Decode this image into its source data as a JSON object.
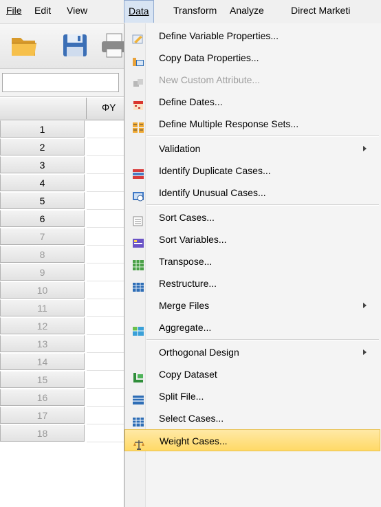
{
  "menubar": {
    "file": "File",
    "edit": "Edit",
    "view": "View",
    "data": "Data",
    "transform": "Transform",
    "analyze": "Analyze",
    "direct_marketing": "Direct Marketi"
  },
  "grid": {
    "col1_label": "ΦY",
    "row_numbers": [
      "1",
      "2",
      "3",
      "4",
      "5",
      "6",
      "7",
      "8",
      "9",
      "10",
      "11",
      "12",
      "13",
      "14",
      "15",
      "16",
      "17",
      "18"
    ]
  },
  "data_menu": {
    "items": [
      {
        "label": "Define Variable Properties...",
        "icon": "define-variable-properties-icon"
      },
      {
        "label": "Copy Data Properties...",
        "icon": "copy-data-properties-icon"
      },
      {
        "label": "New Custom Attribute...",
        "icon": "new-custom-attribute-icon",
        "disabled": true
      },
      {
        "label": "Define Dates...",
        "icon": "calendar-icon"
      },
      {
        "label": "Define Multiple Response Sets...",
        "icon": "multiple-response-icon"
      },
      {
        "label": "Validation",
        "submenu": true
      },
      {
        "label": "Identify Duplicate Cases...",
        "icon": "duplicate-cases-icon"
      },
      {
        "label": "Identify Unusual Cases...",
        "icon": "unusual-cases-icon"
      },
      {
        "label": "Sort Cases...",
        "icon": "sort-cases-icon"
      },
      {
        "label": "Sort Variables...",
        "icon": "sort-variables-icon"
      },
      {
        "label": "Transpose...",
        "icon": "transpose-icon"
      },
      {
        "label": "Restructure...",
        "icon": "restructure-icon"
      },
      {
        "label": "Merge Files",
        "submenu": true
      },
      {
        "label": "Aggregate...",
        "icon": "aggregate-icon"
      },
      {
        "label": "Orthogonal Design",
        "submenu": true
      },
      {
        "label": "Copy Dataset",
        "icon": "copy-dataset-icon"
      },
      {
        "label": "Split File...",
        "icon": "split-file-icon"
      },
      {
        "label": "Select Cases...",
        "icon": "select-cases-icon"
      },
      {
        "label": "Weight Cases...",
        "icon": "weight-cases-icon",
        "highlighted": true
      }
    ]
  },
  "colors": {
    "highlight": "#ffd966",
    "menu_bg": "#f4f4f4",
    "active_menu": "#d8e4f3"
  }
}
